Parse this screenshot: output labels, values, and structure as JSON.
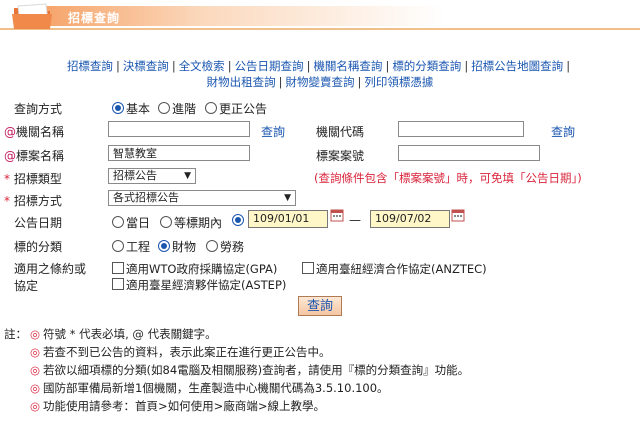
{
  "header": {
    "title": "招標查詢",
    "icon": "folder-icon"
  },
  "nav": {
    "row1": [
      "招標查詢",
      "決標查詢",
      "全文檢索",
      "公告日期查詢",
      "機關名稱查詢",
      "標的分類查詢",
      "招標公告地圖查詢"
    ],
    "row2": [
      "財物出租查詢",
      "財物變賣查詢",
      "列印領標憑據"
    ],
    "separator": "|"
  },
  "form": {
    "query_mode": {
      "label": "查詢方式",
      "options": [
        "基本",
        "進階",
        "更正公告"
      ],
      "selected": "基本"
    },
    "agency_name": {
      "marker": "@",
      "label": "機關名稱",
      "value": "",
      "lookup": "查詢"
    },
    "agency_code": {
      "label": "機關代碼",
      "value": "",
      "lookup": "查詢"
    },
    "case_name": {
      "marker": "@",
      "label": "標案名稱",
      "value": "智慧教室"
    },
    "case_no": {
      "label": "標案案號",
      "value": ""
    },
    "tender_type": {
      "marker": "*",
      "label": "招標類型",
      "value": "招標公告"
    },
    "tender_note": "(查詢條件包含「標案案號」時，可免填「公告日期」)",
    "tender_method": {
      "marker": "*",
      "label": "招標方式",
      "value": "各式招標公告"
    },
    "announce_date": {
      "label": "公告日期",
      "options": [
        "當日",
        "等標期內"
      ],
      "from": "109/01/01",
      "dash": "—",
      "to": "109/07/02"
    },
    "category": {
      "label": "標的分類",
      "options": [
        "工程",
        "財物",
        "勞務"
      ],
      "selected": "財物"
    },
    "treaty": {
      "label_line1": "適用之條約或",
      "label_line2": "協定",
      "options": [
        "適用WTO政府採購協定(GPA)",
        "適用臺紐經濟合作協定(ANZTEC)",
        "適用臺星經濟夥伴協定(ASTEP)"
      ]
    },
    "submit_label": "查詢"
  },
  "notes": {
    "prefix": "註：",
    "lines": [
      "符號 * 代表必填, @ 代表關鍵字。",
      "若查不到已公告的資料，表示此案正在進行更正公告中。",
      "若欲以細項標的分類(如84電腦及相關服務)查詢者，請使用『標的分類查詢』功能。",
      "國防部軍備局新增1個機關，生產製造中心機關代碼為3.5.10.100。",
      "功能使用請參考：首頁>如何使用>廠商端>線上教學。"
    ],
    "bullet": "◎"
  },
  "colors": {
    "link": "#1a56b0",
    "required": "#d9243b",
    "date_bg": "#fff7c8",
    "header": "#f6a46a"
  }
}
